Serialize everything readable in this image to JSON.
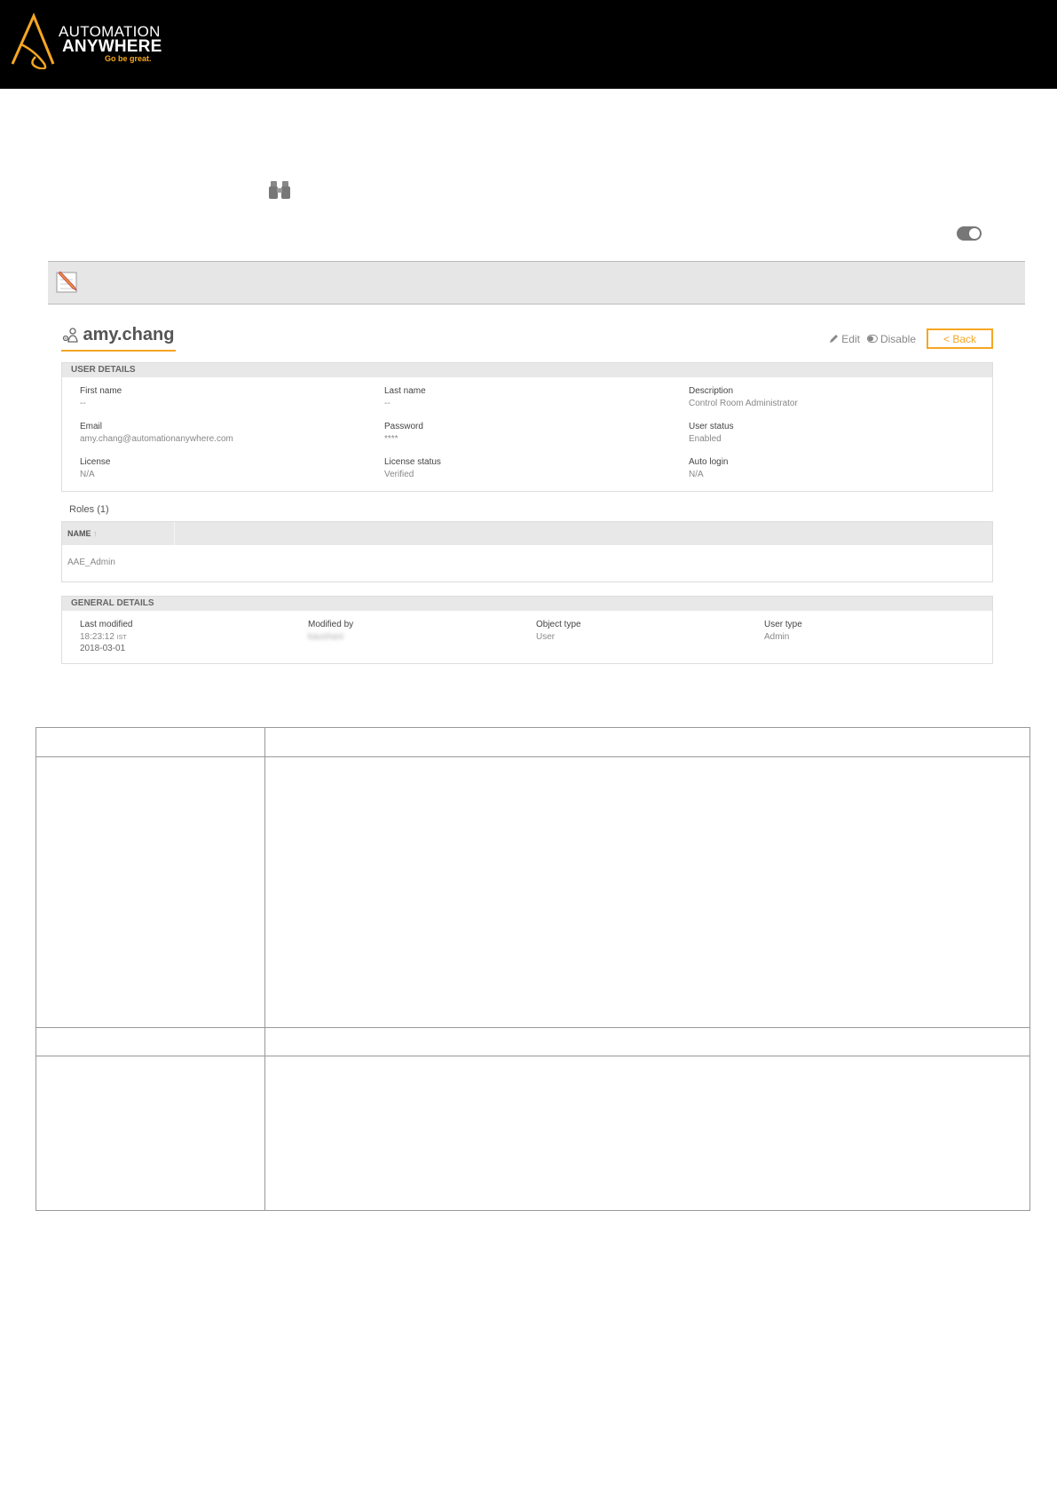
{
  "header": {
    "logo_line1": "AUTOMATION",
    "logo_line2": "ANYWHERE",
    "logo_tagline": "Go be great.",
    "brand_color": "#f5a623"
  },
  "icons": {
    "search": "binoculars-icon",
    "toggle": "toggle-icon",
    "edit_note": "pencil-note-icon"
  },
  "user": {
    "username": "amy.chang",
    "actions": {
      "edit_label": "Edit",
      "disable_label": "Disable",
      "back_label": "< Back"
    }
  },
  "user_details": {
    "heading": "USER DETAILS",
    "fields": [
      {
        "label": "First name",
        "value": "--"
      },
      {
        "label": "Last name",
        "value": "--"
      },
      {
        "label": "Description",
        "value": "Control Room Administrator"
      },
      {
        "label": "Email",
        "value": "amy.chang@automationanywhere.com"
      },
      {
        "label": "Password",
        "value": "****"
      },
      {
        "label": "User status",
        "value": "Enabled"
      },
      {
        "label": "License",
        "value": "N/A"
      },
      {
        "label": "License status",
        "value": "Verified"
      },
      {
        "label": "Auto login",
        "value": "N/A"
      }
    ]
  },
  "roles": {
    "title": "Roles",
    "count": "(1)",
    "column_name": "NAME",
    "sort_indicator": "↑",
    "rows": [
      "AAE_Admin"
    ]
  },
  "general_details": {
    "heading": "GENERAL DETAILS",
    "last_modified_label": "Last modified",
    "last_modified_time": "18:23:12",
    "last_modified_tz": "IST",
    "last_modified_date": "2018-03-01",
    "modified_by_label": "Modified by",
    "modified_by_value": "kaushani",
    "object_type_label": "Object type",
    "object_type_value": "User",
    "user_type_label": "User type",
    "user_type_value": "Admin"
  }
}
